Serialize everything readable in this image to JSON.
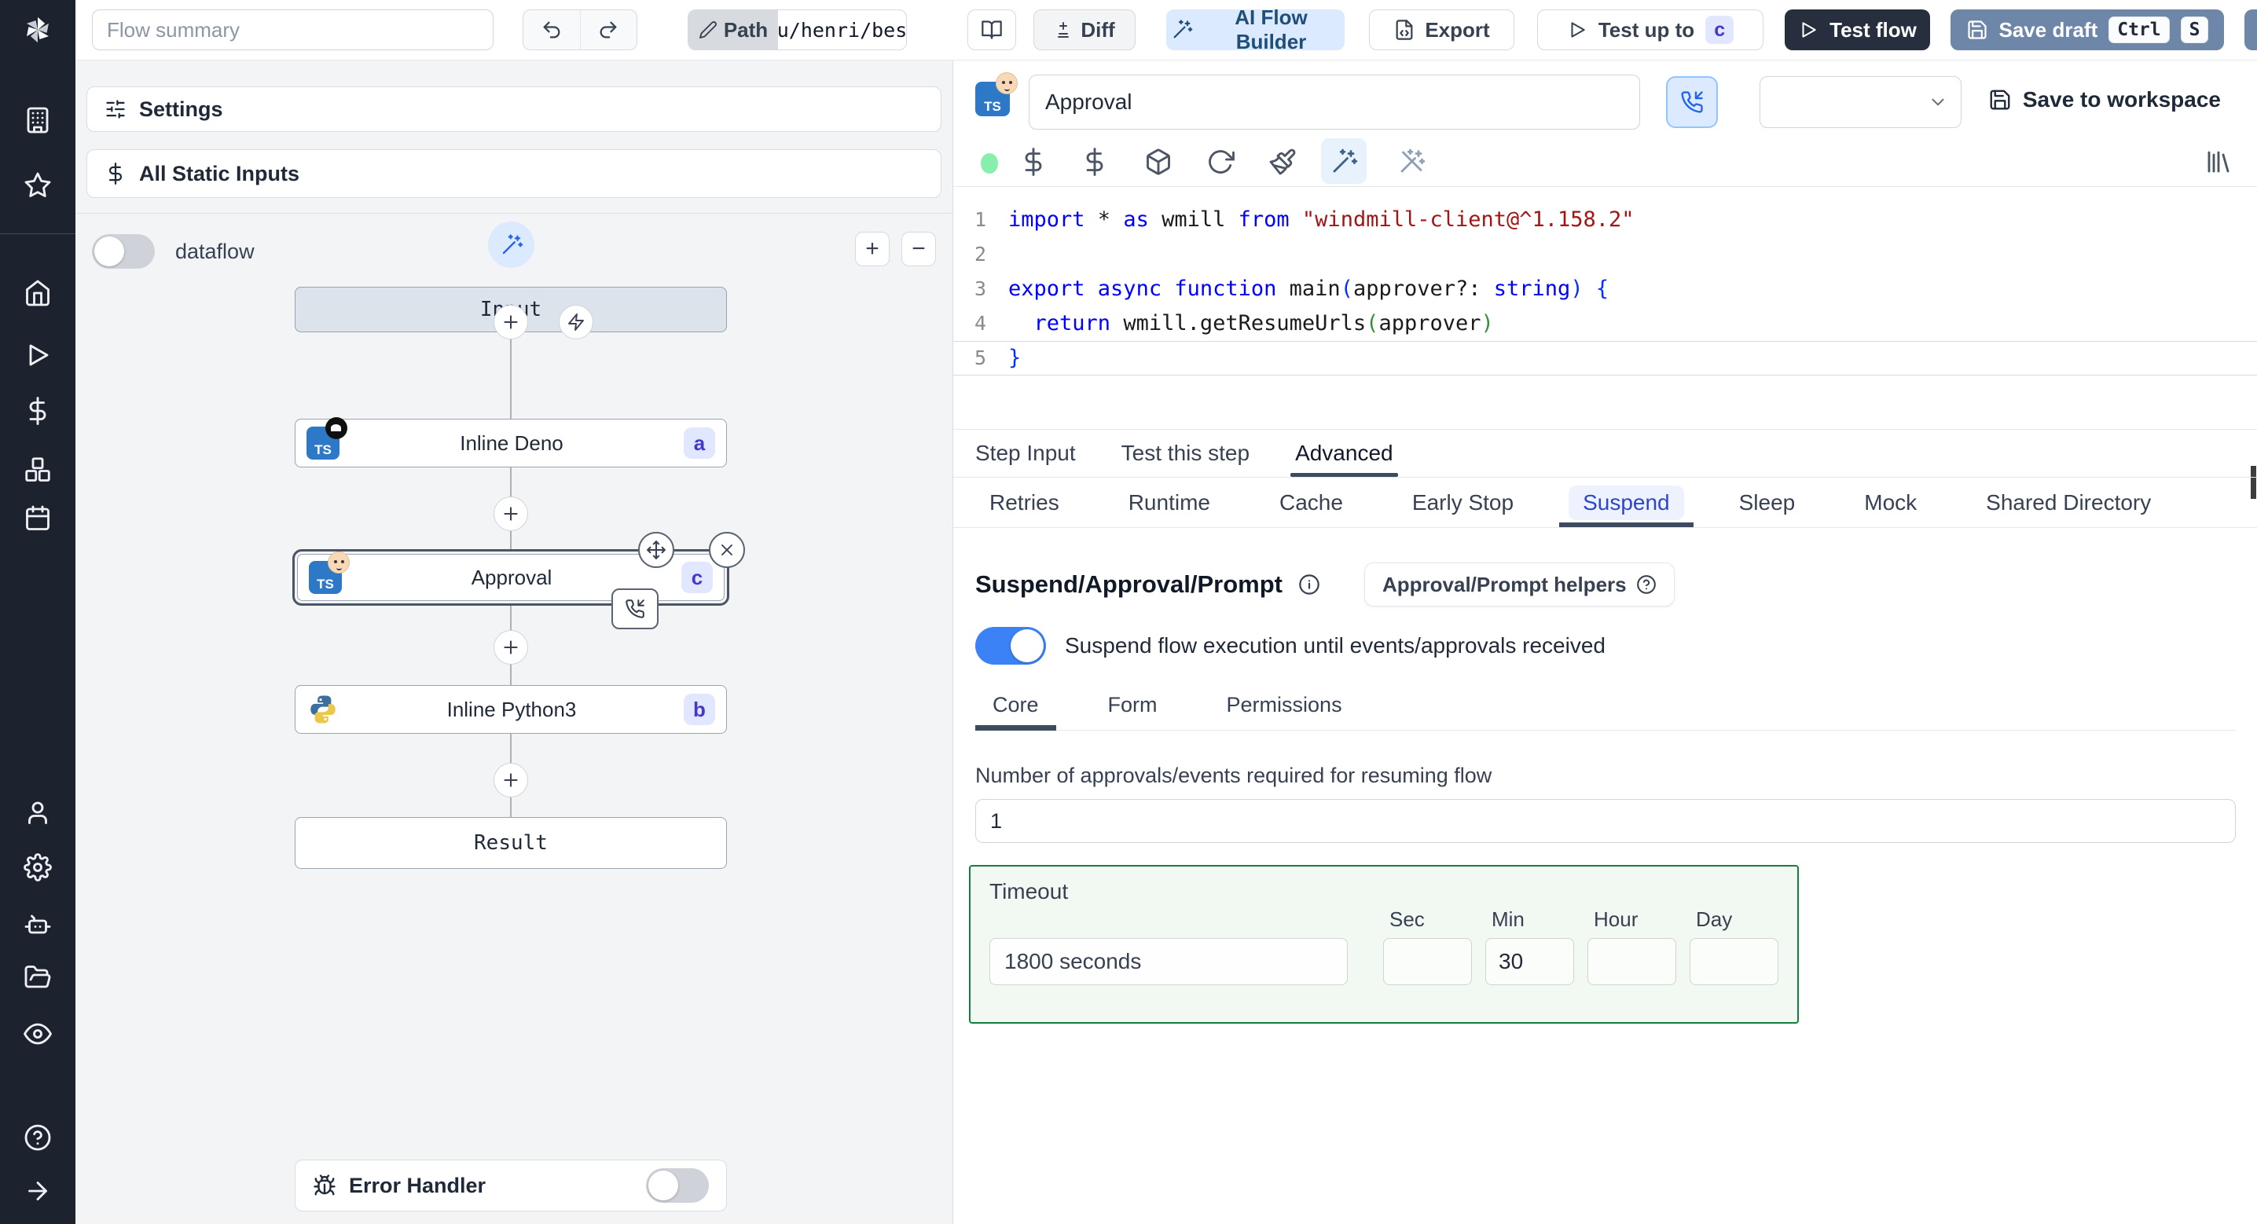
{
  "topbar": {
    "flow_summary_placeholder": "Flow summary",
    "path_label": "Path",
    "path_value": "u/henri/bes",
    "diff_label": "Diff",
    "ai_flow_builder_label": "AI Flow Builder",
    "export_label": "Export",
    "test_up_to_label": "Test up to",
    "test_up_to_badge": "c",
    "test_flow_label": "Test flow",
    "save_draft_label": "Save draft",
    "save_draft_kbd_1": "Ctrl",
    "save_draft_kbd_2": "S"
  },
  "sidebar": {
    "icons": [
      "windmill-logo",
      "building",
      "star",
      "home",
      "play",
      "dollar",
      "boxes",
      "calendar",
      "user",
      "settings",
      "bot",
      "folder-open",
      "eye",
      "help-circle",
      "arrow-right"
    ]
  },
  "flow_panel": {
    "settings_label": "Settings",
    "static_inputs_label": "All Static Inputs",
    "dataflow_label": "dataflow",
    "zoom_in_label": "+",
    "zoom_out_label": "−",
    "error_handler_label": "Error Handler",
    "graph": {
      "nodes": [
        {
          "label": "Input",
          "type": "virtual"
        },
        {
          "label": "Inline Deno",
          "badge": "a",
          "icon": "typescript-deno"
        },
        {
          "label": "Approval",
          "badge": "c",
          "icon": "typescript-emoji",
          "selected": true
        },
        {
          "label": "Inline Python3",
          "badge": "b",
          "icon": "python"
        },
        {
          "label": "Result",
          "type": "virtual"
        }
      ]
    }
  },
  "editor": {
    "step_name": "Approval",
    "save_to_workspace_label": "Save to workspace",
    "toolbar_icons": [
      "status-dot",
      "variable-dollar",
      "context-dollar",
      "package",
      "refresh",
      "paintbrush",
      "magic-wand",
      "wand-off",
      "library"
    ],
    "tabs": [
      "Step Input",
      "Test this step",
      "Advanced"
    ],
    "active_tab": "Advanced",
    "subtabs": [
      "Retries",
      "Runtime",
      "Cache",
      "Early Stop",
      "Suspend",
      "Sleep",
      "Mock",
      "Shared Directory"
    ],
    "active_subtab": "Suspend",
    "code": {
      "language": "typescript",
      "cursor_line": 5,
      "lines": [
        [
          {
            "t": "import ",
            "c": "kw"
          },
          {
            "t": "* ",
            "c": "pl"
          },
          {
            "t": "as ",
            "c": "kw"
          },
          {
            "t": "wmill ",
            "c": "pl"
          },
          {
            "t": "from ",
            "c": "kw"
          },
          {
            "t": "\"windmill-client@^1.158.2\"",
            "c": "str"
          }
        ],
        [],
        [
          {
            "t": "export ",
            "c": "kw"
          },
          {
            "t": "async ",
            "c": "kw"
          },
          {
            "t": "function ",
            "c": "kw"
          },
          {
            "t": "main",
            "c": "pl"
          },
          {
            "t": "(",
            "c": "b1"
          },
          {
            "t": "approver",
            "c": "pl"
          },
          {
            "t": "?: ",
            "c": "pl"
          },
          {
            "t": "string",
            "c": "kw"
          },
          {
            "t": ") {",
            "c": "b1"
          }
        ],
        [
          {
            "t": "  ",
            "c": "pl"
          },
          {
            "t": "return ",
            "c": "kw"
          },
          {
            "t": "wmill.getResumeUrls",
            "c": "pl"
          },
          {
            "t": "(",
            "c": "b2"
          },
          {
            "t": "approver",
            "c": "pl"
          },
          {
            "t": ")",
            "c": "b2"
          }
        ],
        [
          {
            "t": "}",
            "c": "b1"
          }
        ]
      ]
    }
  },
  "suspend": {
    "heading": "Suspend/Approval/Prompt",
    "helpers_button_label": "Approval/Prompt helpers",
    "toggle_label": "Suspend flow execution until events/approvals received",
    "toggle_on": true,
    "tabs": [
      "Core",
      "Form",
      "Permissions"
    ],
    "active_tab": "Core",
    "approvals_label": "Number of approvals/events required for resuming flow",
    "approvals_value": "1",
    "timeout": {
      "label": "Timeout",
      "display_value": "1800 seconds",
      "units": [
        {
          "label": "Sec",
          "value": ""
        },
        {
          "label": "Min",
          "value": "30"
        },
        {
          "label": "Hour",
          "value": ""
        },
        {
          "label": "Day",
          "value": ""
        }
      ]
    }
  },
  "colors": {
    "rail_bg": "#1c222e",
    "accent_blue": "#2563eb",
    "badge_bg": "#e0e7ff",
    "badge_text": "#4338ca",
    "save_draft_bg": "#6e86a8",
    "test_flow_bg": "#272e3d",
    "timeout_border": "#15803d",
    "code_keyword": "#0000ff",
    "code_string": "#a31515"
  }
}
